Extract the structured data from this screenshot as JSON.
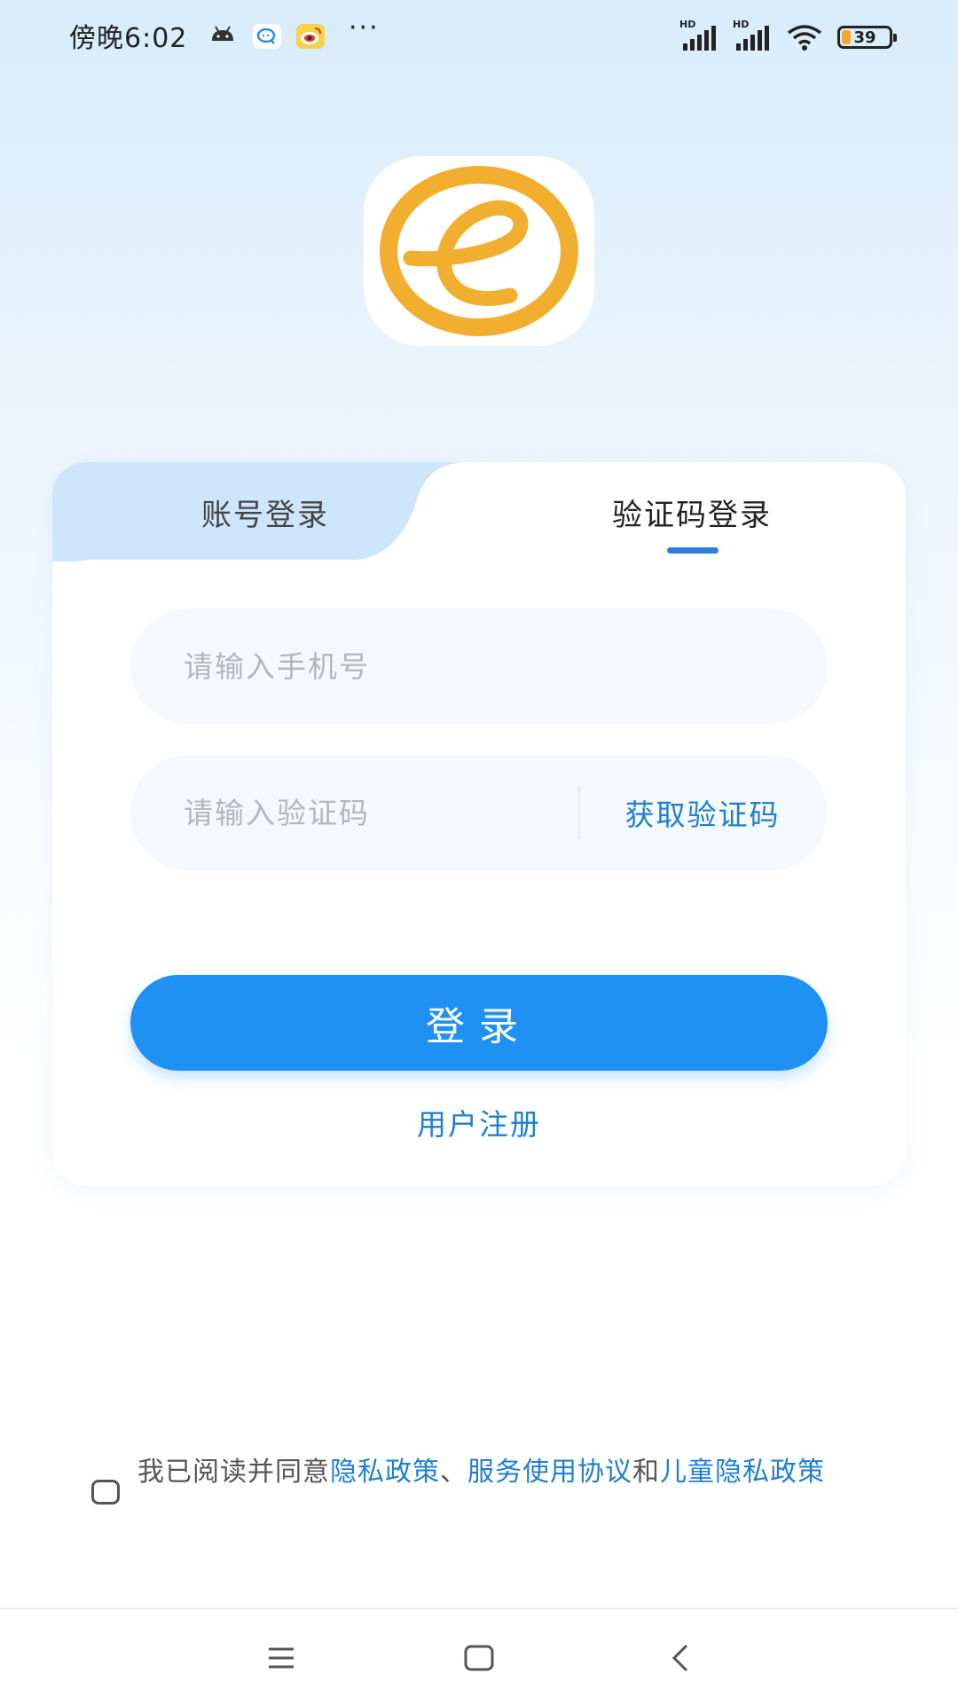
{
  "status_bar": {
    "time": "傍晚6:02",
    "more": "···",
    "signal1_label": "HD",
    "signal2_label": "HD",
    "battery": "39",
    "icons": [
      "android-icon",
      "chat-bubble-icon",
      "weibo-icon",
      "signal-icon",
      "wifi-icon",
      "battery-icon"
    ]
  },
  "logo": {
    "icon": "elephant-e-logo",
    "color": "#F2AE2E"
  },
  "tabs": {
    "account": "账号登录",
    "code": "验证码登录",
    "active": "code"
  },
  "phone_field": {
    "placeholder": "请输入手机号",
    "value": ""
  },
  "code_field": {
    "placeholder": "请输入验证码",
    "value": "",
    "get_code_label": "获取验证码"
  },
  "login_button": {
    "label": "登录"
  },
  "register_link": {
    "label": "用户注册"
  },
  "agreement": {
    "prefix": "我已阅读并同意",
    "privacy": "隐私政策",
    "sep1": "、",
    "service": "服务使用协议",
    "and": "和",
    "child_privacy": "儿童隐私政策",
    "checked": false
  },
  "nav": {
    "icons": [
      "menu-icon",
      "home-icon",
      "back-icon"
    ]
  },
  "colors": {
    "accent": "#1E91F3",
    "link": "#1F7FD0",
    "tab_inactive_bg": "#CDE6FB"
  }
}
